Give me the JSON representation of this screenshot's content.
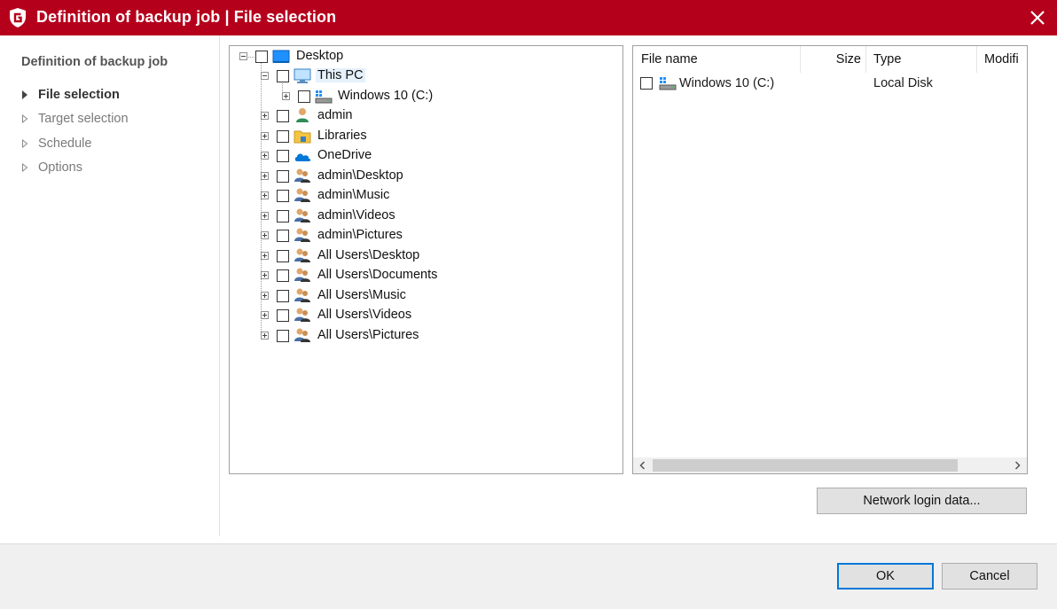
{
  "window": {
    "title": "Definition of backup job | File selection",
    "accent_color": "#b5001c",
    "logo_icon": "g-data-shield-icon",
    "close_icon": "close-icon"
  },
  "nav": {
    "heading": "Definition of backup job",
    "items": [
      {
        "label": "File selection",
        "active": true
      },
      {
        "label": "Target selection",
        "active": false
      },
      {
        "label": "Schedule",
        "active": false
      },
      {
        "label": "Options",
        "active": false
      }
    ]
  },
  "tree": {
    "nodes": [
      {
        "label": "Desktop",
        "icon": "desktop-icon",
        "expander": "minus",
        "checked": false
      },
      {
        "label": "This PC",
        "icon": "this-pc-icon",
        "expander": "minus",
        "checked": false,
        "selected": true
      },
      {
        "label": "Windows 10 (C:)",
        "icon": "drive-icon",
        "expander": "plus",
        "checked": false
      },
      {
        "label": "admin",
        "icon": "user-icon",
        "expander": "plus",
        "checked": false
      },
      {
        "label": "Libraries",
        "icon": "libraries-folder-icon",
        "expander": "plus",
        "checked": false
      },
      {
        "label": "OneDrive",
        "icon": "onedrive-cloud-icon",
        "expander": "plus",
        "checked": false
      },
      {
        "label": "admin\\Desktop",
        "icon": "users-group-icon",
        "expander": "plus",
        "checked": false
      },
      {
        "label": "admin\\Music",
        "icon": "users-group-icon",
        "expander": "plus",
        "checked": false
      },
      {
        "label": "admin\\Videos",
        "icon": "users-group-icon",
        "expander": "plus",
        "checked": false
      },
      {
        "label": "admin\\Pictures",
        "icon": "users-group-icon",
        "expander": "plus",
        "checked": false
      },
      {
        "label": "All Users\\Desktop",
        "icon": "users-group-icon",
        "expander": "plus",
        "checked": false
      },
      {
        "label": "All Users\\Documents",
        "icon": "users-group-icon",
        "expander": "plus",
        "checked": false
      },
      {
        "label": "All Users\\Music",
        "icon": "users-group-icon",
        "expander": "plus",
        "checked": false
      },
      {
        "label": "All Users\\Videos",
        "icon": "users-group-icon",
        "expander": "plus",
        "checked": false
      },
      {
        "label": "All Users\\Pictures",
        "icon": "users-group-icon",
        "expander": "plus",
        "checked": false
      }
    ]
  },
  "list": {
    "columns": [
      "File name",
      "Size",
      "Type",
      "Modifi"
    ],
    "rows": [
      {
        "name": "Windows 10 (C:)",
        "size": "",
        "type": "Local Disk",
        "icon": "drive-icon",
        "checked": false
      }
    ]
  },
  "buttons": {
    "network_login": "Network login data...",
    "ok": "OK",
    "cancel": "Cancel"
  }
}
